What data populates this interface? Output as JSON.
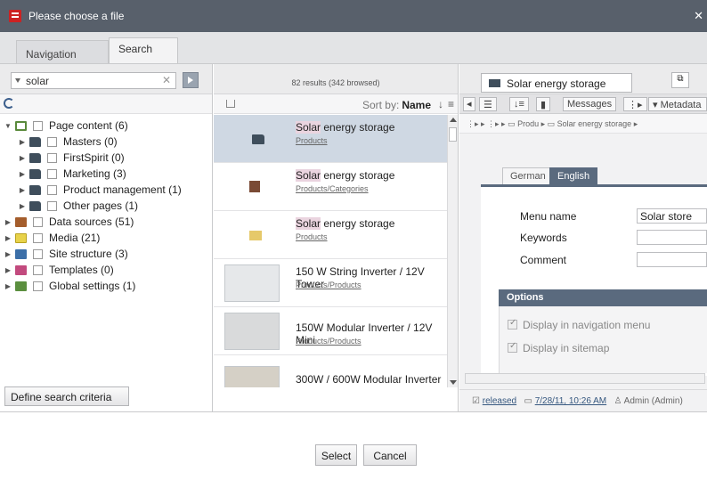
{
  "window": {
    "title": "Please choose a file",
    "close_glyph": "✕"
  },
  "tabs": [
    {
      "label": "Navigation",
      "active": false
    },
    {
      "label": "Search",
      "active": true
    }
  ],
  "search": {
    "value": "solar",
    "clear_glyph": "✕"
  },
  "tree": [
    {
      "label": "Page content  (6)",
      "icon": "page-icon",
      "expanded": true,
      "level": 0
    },
    {
      "label": "Masters  (0)",
      "icon": "folder-icon",
      "level": 1
    },
    {
      "label": "FirstSpirit  (0)",
      "icon": "folder-icon",
      "level": 1
    },
    {
      "label": "Marketing  (3)",
      "icon": "folder-icon",
      "level": 1
    },
    {
      "label": "Product management  (1)",
      "icon": "folder-icon",
      "level": 1
    },
    {
      "label": "Other pages  (1)",
      "icon": "folder-icon",
      "level": 1
    },
    {
      "label": "Data sources  (51)",
      "icon": "datasource-icon",
      "level": 0
    },
    {
      "label": "Media  (21)",
      "icon": "media-icon",
      "level": 0
    },
    {
      "label": "Site structure  (3)",
      "icon": "site-structure-icon",
      "level": 0
    },
    {
      "label": "Templates  (0)",
      "icon": "templates-icon",
      "level": 0
    },
    {
      "label": "Global settings  (1)",
      "icon": "global-settings-icon",
      "level": 0
    }
  ],
  "left_footer": {
    "define_button": "Define search criteria"
  },
  "results": {
    "summary": "82 results (342 browsed)",
    "sort_label": "Sort by:",
    "sort_value": "Name",
    "sort_arrow": "↓",
    "list_glyph": "≡",
    "items": [
      {
        "highlight": "Solar",
        "title_rest": " energy storage",
        "path": "Products",
        "icon": "folder-icon",
        "selected": true
      },
      {
        "highlight": "Solar",
        "title_rest": " energy storage",
        "path": "Products/Categories",
        "icon": "page-icon",
        "selected": false
      },
      {
        "highlight": "Solar",
        "title_rest": " energy storage",
        "path": "Products",
        "icon": "folder-icon",
        "selected": false
      },
      {
        "highlight": "",
        "title_rest": "150 W String Inverter / 12V Tower",
        "path": "Products/Products",
        "icon": "product-thumbnail",
        "selected": false
      },
      {
        "highlight": "",
        "title_rest": "150W Modular Inverter / 12V Mini",
        "path": "Products/Products",
        "icon": "product-thumbnail",
        "selected": false
      },
      {
        "highlight": "",
        "title_rest": "300W / 600W Modular Inverter",
        "path": "",
        "icon": "product-thumbnail",
        "selected": false
      }
    ]
  },
  "detail": {
    "title": "Solar energy storage",
    "toolbar": {
      "messages": "Messages",
      "metadata": "Metadata"
    },
    "breadcrumb": {
      "item1": "Produ",
      "item2": "Solar energy storage"
    },
    "languages": {
      "inactive": "German",
      "active": "English"
    },
    "form": {
      "menu_name_label": "Menu name",
      "menu_name_value": "Solar store",
      "keywords_label": "Keywords",
      "comment_label": "Comment"
    },
    "options": {
      "heading": "Options",
      "nav_menu": "Display in navigation menu",
      "sitemap": "Display in sitemap"
    },
    "status": {
      "state": "released",
      "date": "7/28/11, 10:26 AM",
      "user": "Admin (Admin)"
    }
  },
  "footer": {
    "select": "Select",
    "cancel": "Cancel"
  },
  "colors": {
    "titlebar": "#58606b",
    "accent": "#5a6a7e",
    "selection": "#cfd8e3",
    "highlight": "#ead4df"
  }
}
